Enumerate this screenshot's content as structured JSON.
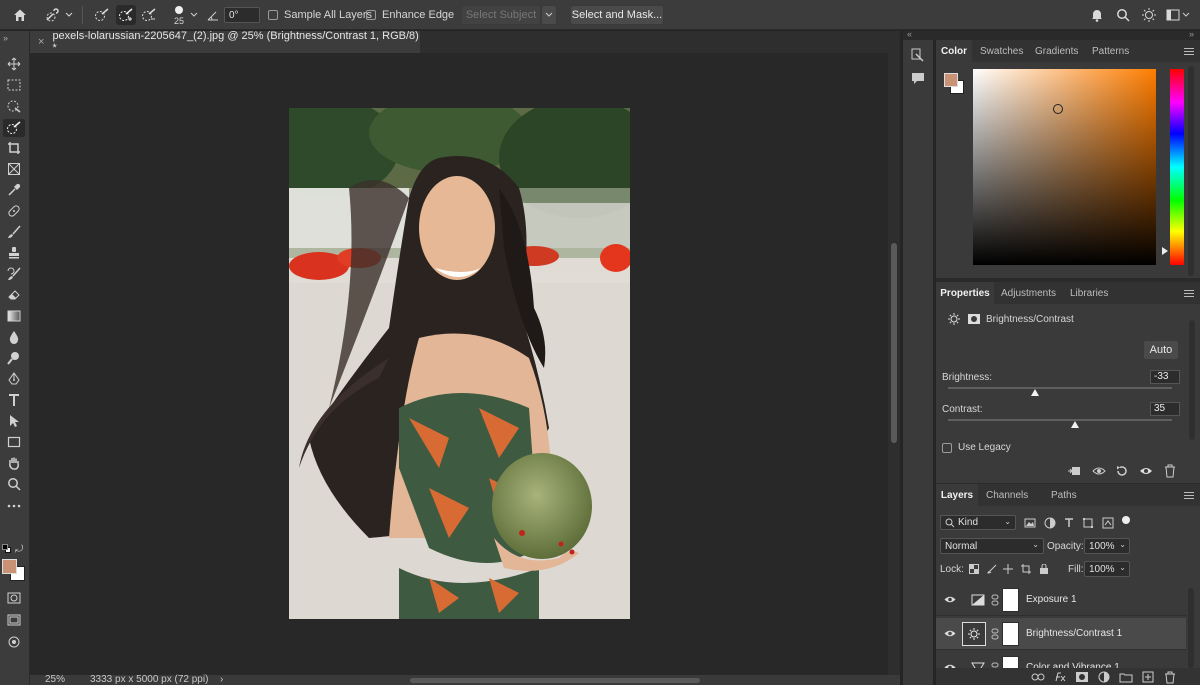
{
  "options_bar": {
    "brush_size": "25",
    "angle": "0°",
    "sample_all_layers": "Sample All Layers",
    "enhance_edge": "Enhance Edge",
    "select_subject": "Select Subject",
    "select_and_mask": "Select and Mask..."
  },
  "document_tab": {
    "title": "pexels-lolarussian-2205647_(2).jpg @ 25% (Brightness/Contrast 1, RGB/8) *",
    "close": "×"
  },
  "status_bar": {
    "zoom": "25%",
    "doc_info": "3333 px x 5000 px (72 ppi)",
    "more": "›"
  },
  "color_panel": {
    "tabs": [
      "Color",
      "Swatches",
      "Gradients",
      "Patterns"
    ],
    "foreground_color": "#c99274",
    "hue_color": "#ff7d00"
  },
  "properties_panel": {
    "tabs": [
      "Properties",
      "Adjustments",
      "Libraries"
    ],
    "adjustment_name": "Brightness/Contrast",
    "auto_label": "Auto",
    "brightness_label": "Brightness:",
    "brightness_value": "-33",
    "brightness_level": -33,
    "contrast_label": "Contrast:",
    "contrast_value": "35",
    "contrast_level": 35,
    "use_legacy": "Use Legacy"
  },
  "layers_panel": {
    "tabs": [
      "Layers",
      "Channels",
      "Paths"
    ],
    "filter_kind": "Kind",
    "blend_mode": "Normal",
    "opacity_label": "Opacity:",
    "opacity_value": "100%",
    "lock_label": "Lock:",
    "fill_label": "Fill:",
    "fill_value": "100%",
    "layers": [
      {
        "name": "Exposure 1",
        "selected": false
      },
      {
        "name": "Brightness/Contrast 1",
        "selected": true
      },
      {
        "name": "Color and Vibrance 1",
        "selected": false
      }
    ]
  }
}
